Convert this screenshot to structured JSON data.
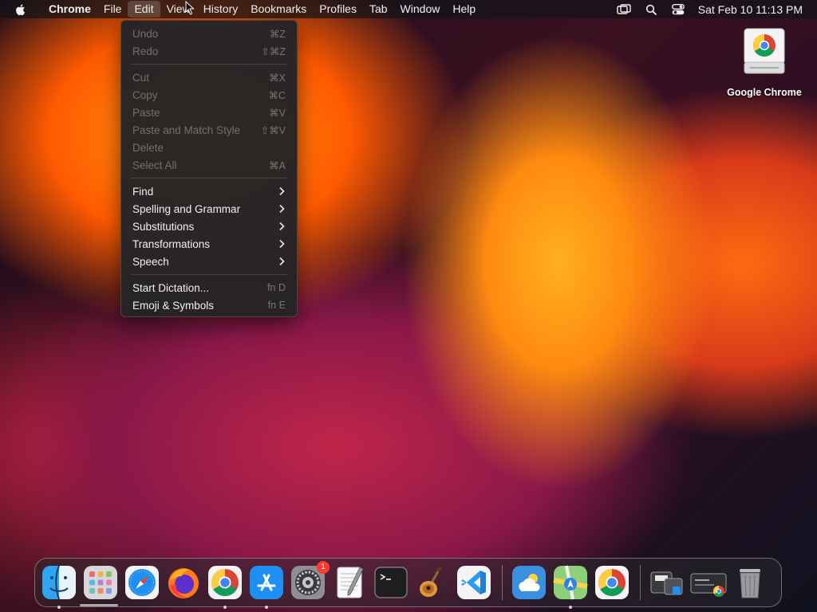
{
  "menubar": {
    "app_name": "Chrome",
    "menus": [
      "File",
      "Edit",
      "View",
      "History",
      "Bookmarks",
      "Profiles",
      "Tab",
      "Window",
      "Help"
    ],
    "active_menu": "Edit",
    "clock": "Sat Feb 10  11:13 PM"
  },
  "edit_menu": {
    "group1": [
      {
        "label": "Undo",
        "shortcut": "⌘Z"
      },
      {
        "label": "Redo",
        "shortcut": "⇧⌘Z"
      }
    ],
    "group2": [
      {
        "label": "Cut",
        "shortcut": "⌘X"
      },
      {
        "label": "Copy",
        "shortcut": "⌘C"
      },
      {
        "label": "Paste",
        "shortcut": "⌘V"
      },
      {
        "label": "Paste and Match Style",
        "shortcut": "⇧⌘V"
      },
      {
        "label": "Delete",
        "shortcut": ""
      },
      {
        "label": "Select All",
        "shortcut": "⌘A"
      }
    ],
    "group3": [
      {
        "label": "Find"
      },
      {
        "label": "Spelling and Grammar"
      },
      {
        "label": "Substitutions"
      },
      {
        "label": "Transformations"
      },
      {
        "label": "Speech"
      }
    ],
    "group4": [
      {
        "label": "Start Dictation...",
        "shortcut": "fn D"
      },
      {
        "label": "Emoji & Symbols",
        "shortcut": "fn E"
      }
    ]
  },
  "desktop_icon": {
    "label": "Google Chrome",
    "icon": "chrome-installer-disk-icon"
  },
  "dock": {
    "apps": [
      {
        "name": "Finder",
        "icon": "finder-icon",
        "running": true
      },
      {
        "name": "Launchpad",
        "icon": "launchpad-icon",
        "running": false
      },
      {
        "name": "Safari",
        "icon": "safari-icon",
        "running": false
      },
      {
        "name": "Firefox",
        "icon": "firefox-icon",
        "running": false
      },
      {
        "name": "Google Chrome",
        "icon": "chrome-icon",
        "running": true
      },
      {
        "name": "App Store",
        "icon": "app-store-icon",
        "running": true
      },
      {
        "name": "System Settings",
        "icon": "settings-icon",
        "running": false,
        "badge": "1"
      },
      {
        "name": "TextEdit",
        "icon": "textedit-icon",
        "running": false
      },
      {
        "name": "Terminal",
        "icon": "terminal-icon",
        "running": false
      },
      {
        "name": "GarageBand",
        "icon": "garageband-icon",
        "running": false
      },
      {
        "name": "Visual Studio Code",
        "icon": "vscode-icon",
        "running": false
      }
    ],
    "recent_apps": [
      {
        "name": "Weather",
        "icon": "weather-icon",
        "running": false
      },
      {
        "name": "Maps",
        "icon": "maps-icon",
        "running": true
      },
      {
        "name": "Google Chrome",
        "icon": "chrome-icon",
        "running": false
      }
    ],
    "stacks": [
      {
        "name": "Applications",
        "icon": "folder-stack-icon"
      },
      {
        "name": "Downloads",
        "icon": "downloads-stack-icon"
      },
      {
        "name": "Trash",
        "icon": "trash-icon"
      }
    ]
  },
  "colors": {
    "menu_bg": "#242426",
    "menu_text": "#f0f0f0",
    "disabled_text": "#707072",
    "badge": "#ff3b30"
  }
}
